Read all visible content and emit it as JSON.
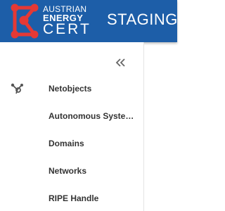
{
  "header": {
    "logo_line1": "AUSTRIAN",
    "logo_line2": "ENERGY",
    "logo_line3": "CERT",
    "environment": "STAGING",
    "bg_color": "#1d5ea8",
    "logo_accent": "#e53935"
  },
  "sidebar": {
    "collapse_icon": "double-chevron-left-icon",
    "items": [
      {
        "label": "Netobjects",
        "icon": "hub-icon"
      },
      {
        "label": "Autonomous Systems"
      },
      {
        "label": "Domains"
      },
      {
        "label": "Networks"
      },
      {
        "label": "RIPE Handle"
      }
    ]
  }
}
